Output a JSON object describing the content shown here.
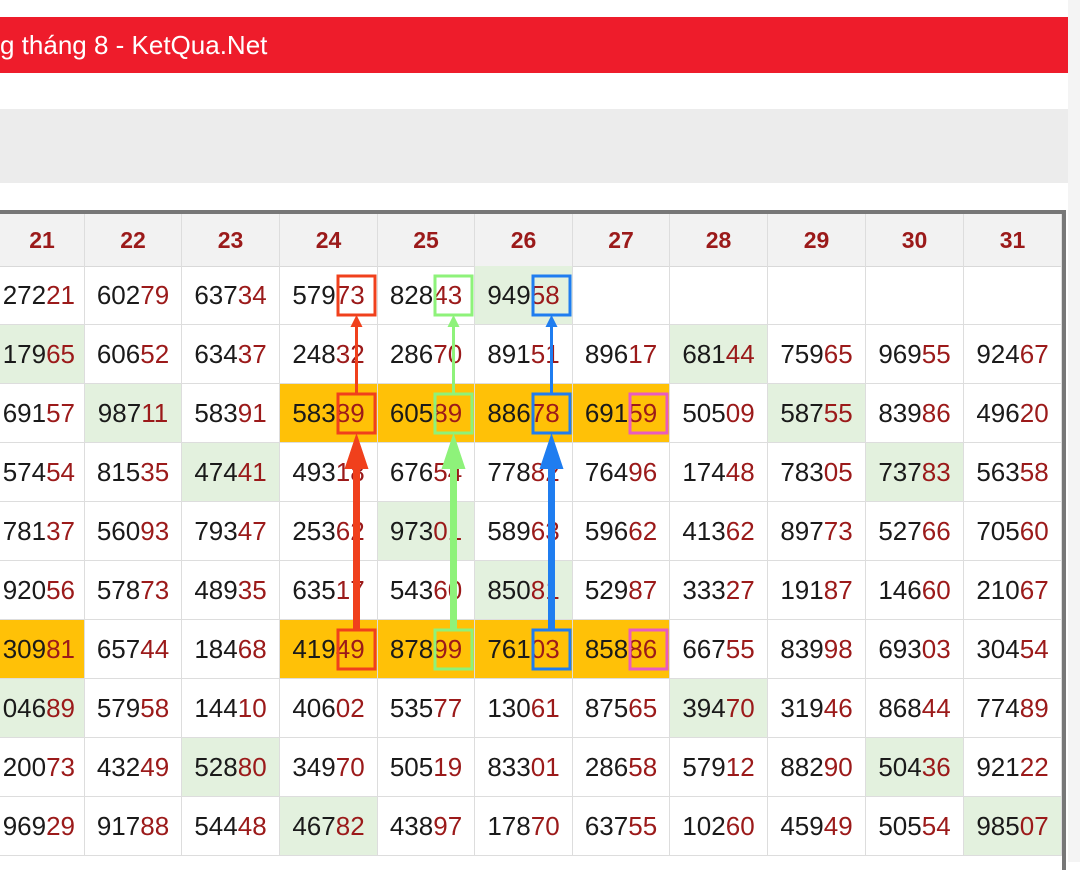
{
  "header": {
    "title": "g tháng 8 - KetQua.Net"
  },
  "colors": {
    "header_bg": "#ee1c2b",
    "highlight": "#ffc107",
    "green": "#e3f1de",
    "tail": "#9b1a1a",
    "arrow_red": "#f0401c",
    "arrow_green": "#8ef27a",
    "arrow_blue": "#1f7df0",
    "box_pink": "#e85cc0"
  },
  "table": {
    "columns": [
      "21",
      "22",
      "23",
      "24",
      "25",
      "26",
      "27",
      "28",
      "29",
      "30",
      "31"
    ],
    "rows": [
      [
        "27221",
        "60279",
        "63734",
        "57973",
        "82843",
        "94958",
        "",
        "",
        "",
        "",
        ""
      ],
      [
        "17965",
        "60652",
        "63437",
        "24832",
        "28670",
        "89151",
        "89617",
        "68144",
        "75965",
        "96955",
        "92467"
      ],
      [
        "69157",
        "98711",
        "58391",
        "58389",
        "60589",
        "88678",
        "69159",
        "50509",
        "58755",
        "83986",
        "49620"
      ],
      [
        "57454",
        "81535",
        "47441",
        "49318",
        "67654",
        "77882",
        "76496",
        "17448",
        "78305",
        "73783",
        "56358"
      ],
      [
        "78137",
        "56093",
        "79347",
        "25362",
        "97301",
        "58963",
        "59662",
        "41362",
        "89773",
        "52766",
        "70560"
      ],
      [
        "92056",
        "57873",
        "48935",
        "63517",
        "54360",
        "85081",
        "52987",
        "33327",
        "19187",
        "14660",
        "21067"
      ],
      [
        "30981",
        "65744",
        "18468",
        "41949",
        "87899",
        "76103",
        "85886",
        "66755",
        "83998",
        "69303",
        "30454"
      ],
      [
        "04689",
        "57958",
        "14410",
        "40602",
        "53577",
        "13061",
        "87565",
        "39470",
        "31946",
        "86844",
        "77489"
      ],
      [
        "20073",
        "43249",
        "52880",
        "34970",
        "50519",
        "83301",
        "28658",
        "57912",
        "88290",
        "50436",
        "92122"
      ],
      [
        "96929",
        "91788",
        "54448",
        "46782",
        "43897",
        "17870",
        "63755",
        "10260",
        "45949",
        "50554",
        "98507"
      ]
    ]
  }
}
